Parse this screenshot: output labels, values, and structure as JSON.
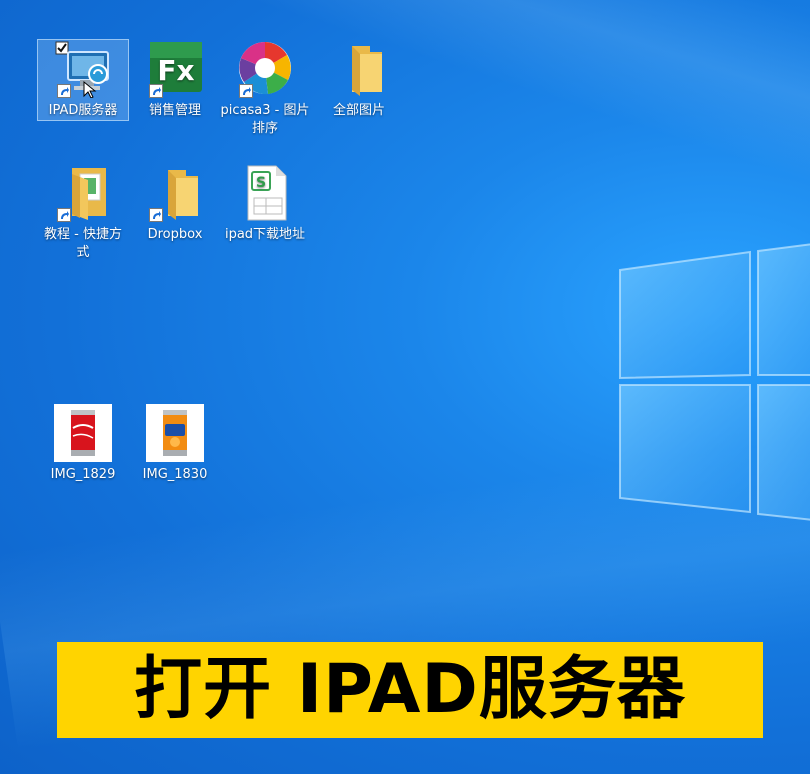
{
  "desktop": {
    "icons": [
      {
        "label": "IPAD服务器",
        "icon": "ipad-server-icon",
        "selected": true,
        "checked": true
      },
      {
        "label": "销售管理",
        "icon": "excel-fx-icon"
      },
      {
        "label": "picasa3 - 图片排序",
        "icon": "picasa-icon"
      },
      {
        "label": "全部图片",
        "icon": "folder-icon"
      },
      {
        "label": "教程 - 快捷方式",
        "icon": "folder-shortcut-icon"
      },
      {
        "label": "Dropbox",
        "icon": "folder-icon"
      },
      {
        "label": "ipad下载地址",
        "icon": "spreadsheet-s-icon"
      },
      {
        "label": "IMG_1829",
        "icon": "coca-cola-can-image"
      },
      {
        "label": "IMG_1830",
        "icon": "fanta-can-image"
      }
    ]
  },
  "caption": {
    "text": "打开 IPAD服务器",
    "background": "#ffd400"
  }
}
